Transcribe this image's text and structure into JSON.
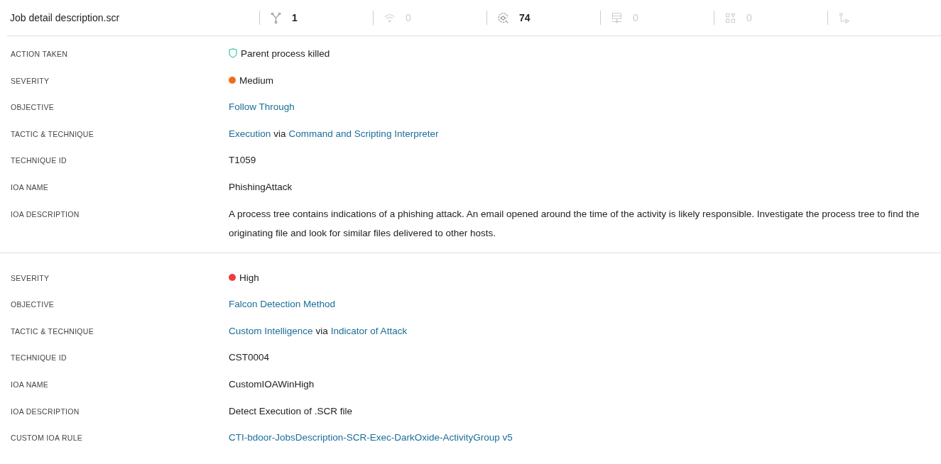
{
  "title": "Job detail description.scr",
  "stats": [
    {
      "kind": "tree",
      "value": "1",
      "active": true
    },
    {
      "kind": "signal",
      "value": "0",
      "active": false
    },
    {
      "kind": "eye",
      "value": "74",
      "active": true
    },
    {
      "kind": "server",
      "value": "0",
      "active": false
    },
    {
      "kind": "grid",
      "value": "0",
      "active": false
    },
    {
      "kind": "flow",
      "active": false
    }
  ],
  "sections": [
    {
      "rows": [
        {
          "label": "ACTION TAKEN",
          "kind": "action",
          "parts": [
            {
              "text": "Parent process killed",
              "link": false
            }
          ]
        },
        {
          "label": "SEVERITY",
          "kind": "severity",
          "color": "#f26b1d",
          "parts": [
            {
              "text": "Medium",
              "link": false
            }
          ]
        },
        {
          "label": "OBJECTIVE",
          "kind": "text",
          "parts": [
            {
              "text": "Follow Through",
              "link": true
            }
          ]
        },
        {
          "label": "TACTIC & TECHNIQUE",
          "kind": "text",
          "parts": [
            {
              "text": "Execution",
              "link": true
            },
            {
              "text": "via",
              "link": false
            },
            {
              "text": "Command and Scripting Interpreter",
              "link": true
            }
          ]
        },
        {
          "label": "TECHNIQUE ID",
          "kind": "text",
          "parts": [
            {
              "text": "T1059",
              "link": false
            }
          ]
        },
        {
          "label": "IOA NAME",
          "kind": "text",
          "parts": [
            {
              "text": "PhishingAttack",
              "link": false
            }
          ]
        },
        {
          "label": "IOA DESCRIPTION",
          "kind": "text",
          "parts": [
            {
              "text": "A process tree contains indications of a phishing attack. An email opened around the time of the activity is likely responsible. Investigate the process tree to find the originating file and look for similar files delivered to other hosts.",
              "link": false
            }
          ]
        }
      ]
    },
    {
      "rows": [
        {
          "label": "SEVERITY",
          "kind": "severity",
          "color": "#f23a3f",
          "parts": [
            {
              "text": "High",
              "link": false
            }
          ]
        },
        {
          "label": "OBJECTIVE",
          "kind": "text",
          "parts": [
            {
              "text": "Falcon Detection Method",
              "link": true
            }
          ]
        },
        {
          "label": "TACTIC & TECHNIQUE",
          "kind": "text",
          "parts": [
            {
              "text": "Custom Intelligence",
              "link": true
            },
            {
              "text": "via",
              "link": false
            },
            {
              "text": "Indicator of Attack",
              "link": true
            }
          ]
        },
        {
          "label": "TECHNIQUE ID",
          "kind": "text",
          "parts": [
            {
              "text": "CST0004",
              "link": false
            }
          ]
        },
        {
          "label": "IOA NAME",
          "kind": "text",
          "parts": [
            {
              "text": "CustomIOAWinHigh",
              "link": false
            }
          ]
        },
        {
          "label": "IOA DESCRIPTION",
          "kind": "text",
          "parts": [
            {
              "text": "Detect Execution of .SCR file",
              "link": false
            }
          ]
        },
        {
          "label": "CUSTOM IOA RULE",
          "kind": "text",
          "parts": [
            {
              "text": "CTI-bdoor-JobsDescription-SCR-Exec-DarkOxide-ActivityGroup v5",
              "link": true
            }
          ]
        }
      ]
    }
  ]
}
